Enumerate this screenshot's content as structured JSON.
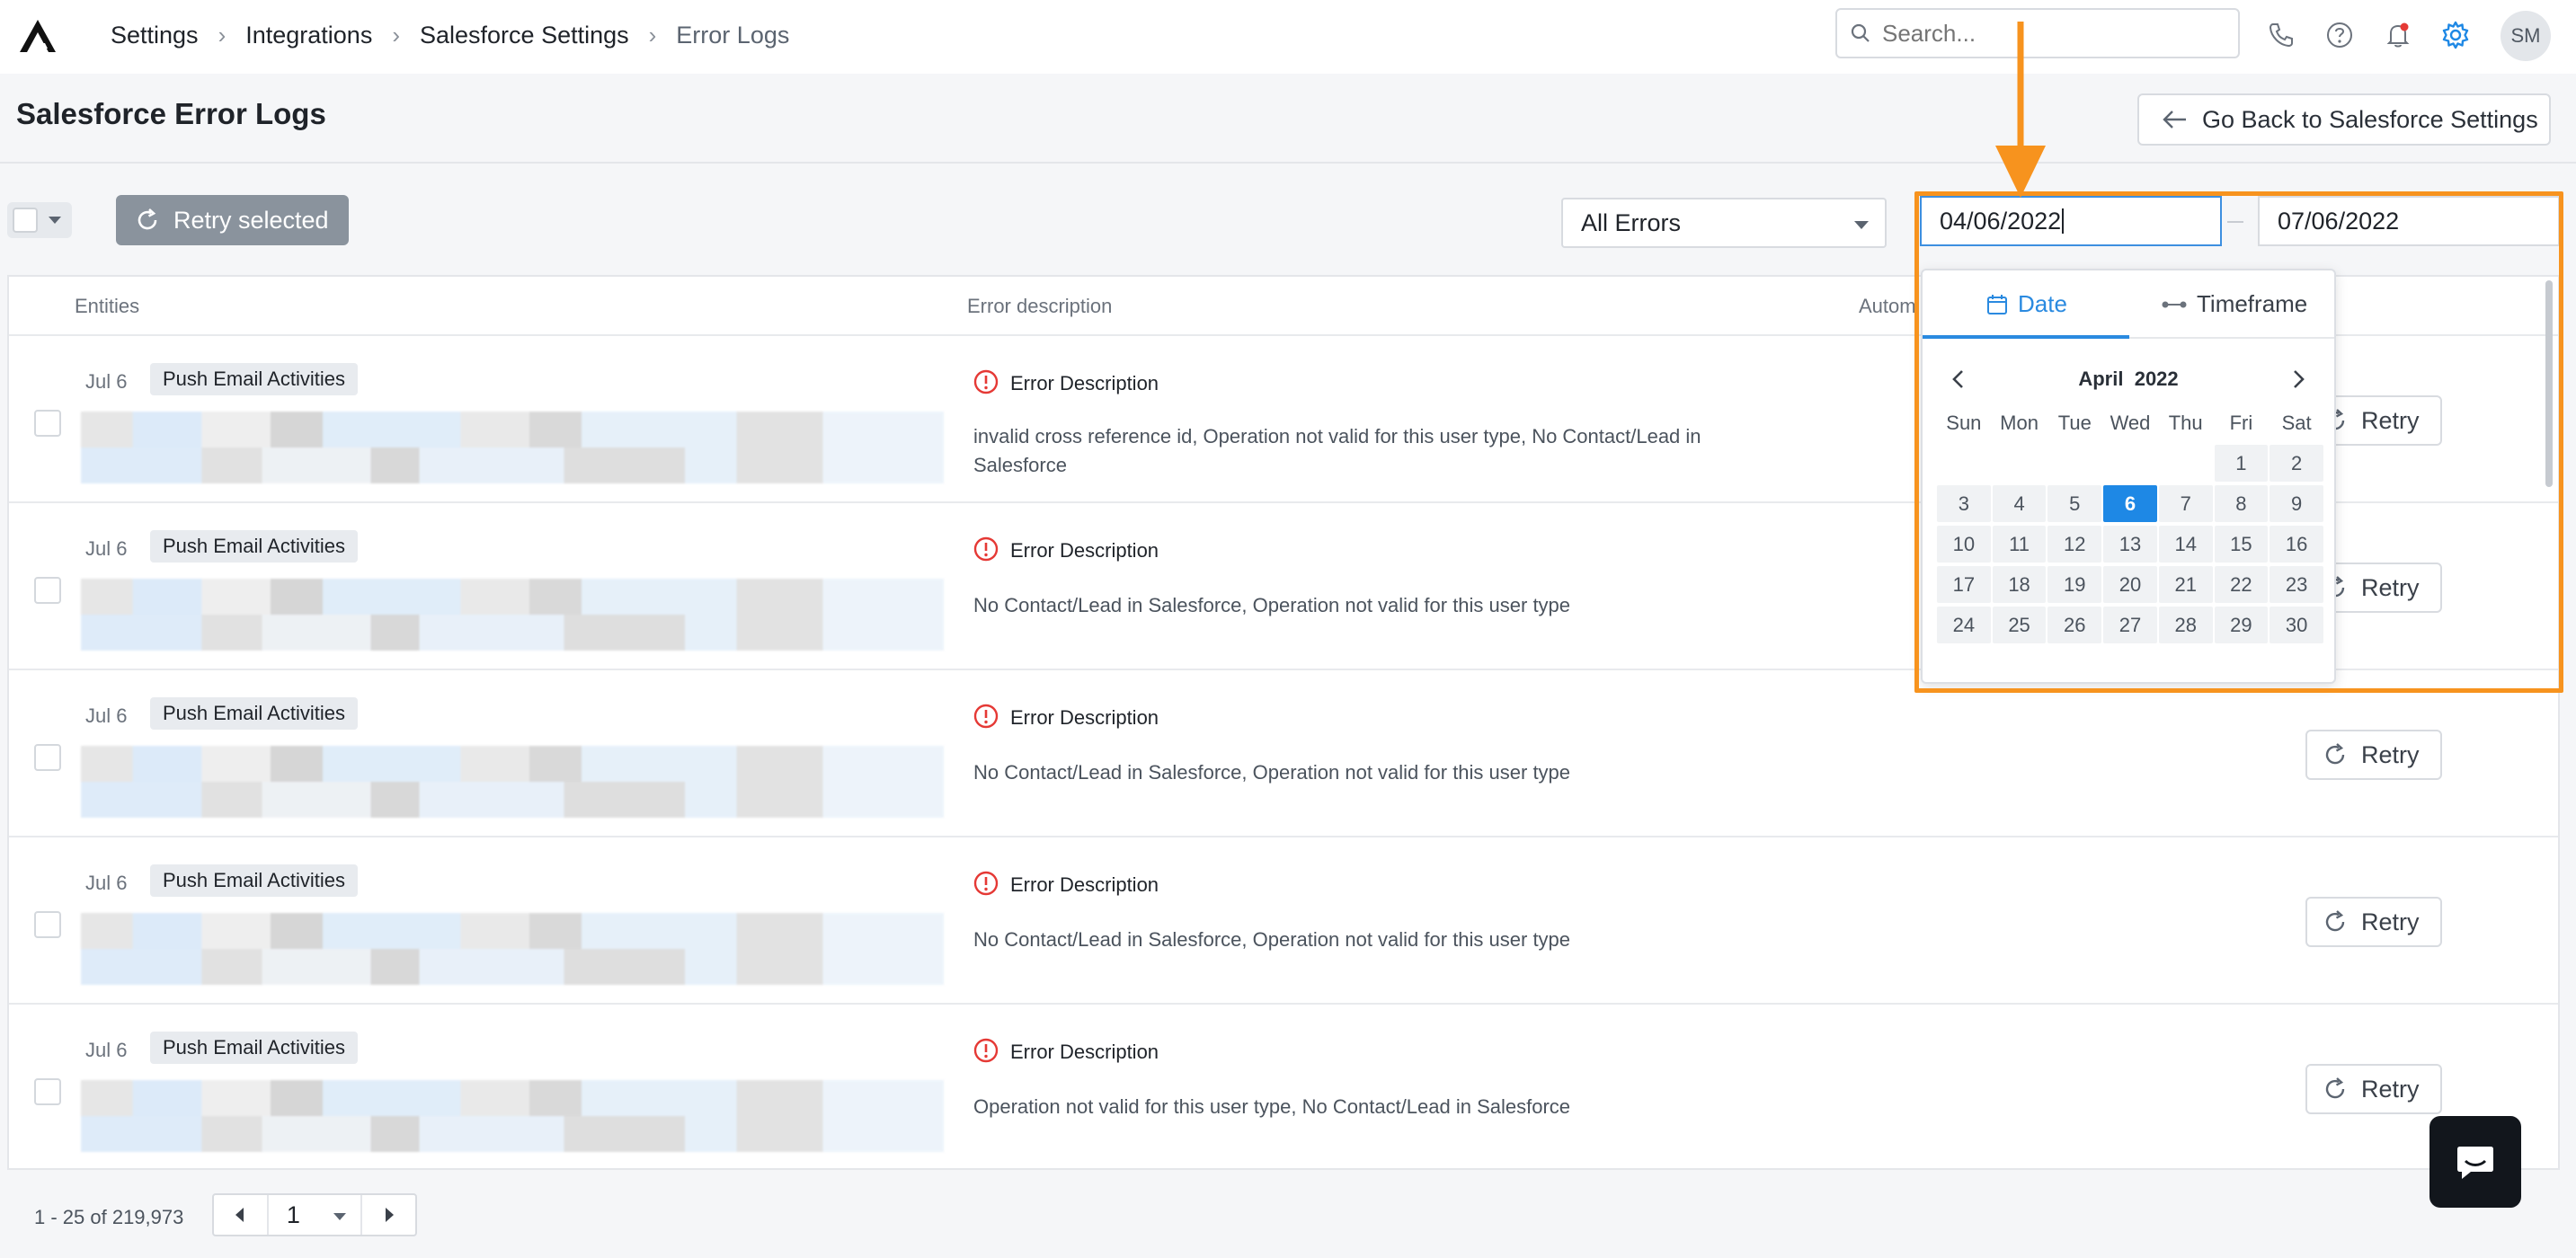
{
  "breadcrumb": [
    "Settings",
    "Integrations",
    "Salesforce Settings",
    "Error Logs"
  ],
  "search": {
    "placeholder": "Search..."
  },
  "user": {
    "initials": "SM"
  },
  "page": {
    "title": "Salesforce Error Logs",
    "back_label": "Go Back to Salesforce Settings"
  },
  "toolbar": {
    "retry_selected_label": "Retry selected",
    "error_filter": "All Errors",
    "date_from": "04/06/2022",
    "date_to": "07/06/2022"
  },
  "table": {
    "columns": [
      "Entities",
      "Error description",
      "Autom"
    ],
    "rows": [
      {
        "date": "Jul 6",
        "tag": "Push Email Activities",
        "error_title": "Error Description",
        "error_text": "invalid cross reference id, Operation not valid for this user type, No Contact/Lead in Salesforce",
        "retry": "Retry"
      },
      {
        "date": "Jul 6",
        "tag": "Push Email Activities",
        "error_title": "Error Description",
        "error_text": "No Contact/Lead in Salesforce, Operation not valid for this user type",
        "retry": "Retry"
      },
      {
        "date": "Jul 6",
        "tag": "Push Email Activities",
        "error_title": "Error Description",
        "error_text": "No Contact/Lead in Salesforce, Operation not valid for this user type",
        "retry": "Retry"
      },
      {
        "date": "Jul 6",
        "tag": "Push Email Activities",
        "error_title": "Error Description",
        "error_text": "No Contact/Lead in Salesforce, Operation not valid for this user type",
        "retry": "Retry"
      },
      {
        "date": "Jul 6",
        "tag": "Push Email Activities",
        "error_title": "Error Description",
        "error_text": "Operation not valid for this user type, No Contact/Lead in Salesforce",
        "retry": "Retry"
      }
    ]
  },
  "calendar": {
    "tabs": [
      "Date",
      "Timeframe"
    ],
    "month": "April",
    "year": "2022",
    "weekdays": [
      "Sun",
      "Mon",
      "Tue",
      "Wed",
      "Thu",
      "Fri",
      "Sat"
    ],
    "leading_blanks": 5,
    "days": [
      "1",
      "2",
      "3",
      "4",
      "5",
      "6",
      "7",
      "8",
      "9",
      "10",
      "11",
      "12",
      "13",
      "14",
      "15",
      "16",
      "17",
      "18",
      "19",
      "20",
      "21",
      "22",
      "23",
      "24",
      "25",
      "26",
      "27",
      "28",
      "29",
      "30"
    ],
    "selected_day": "6"
  },
  "pagination": {
    "range_text": "1 - 25 of 219,973",
    "page": "1"
  },
  "colors": {
    "accent": "#1e88e5",
    "highlight": "#f7931e",
    "error": "#e53935"
  }
}
